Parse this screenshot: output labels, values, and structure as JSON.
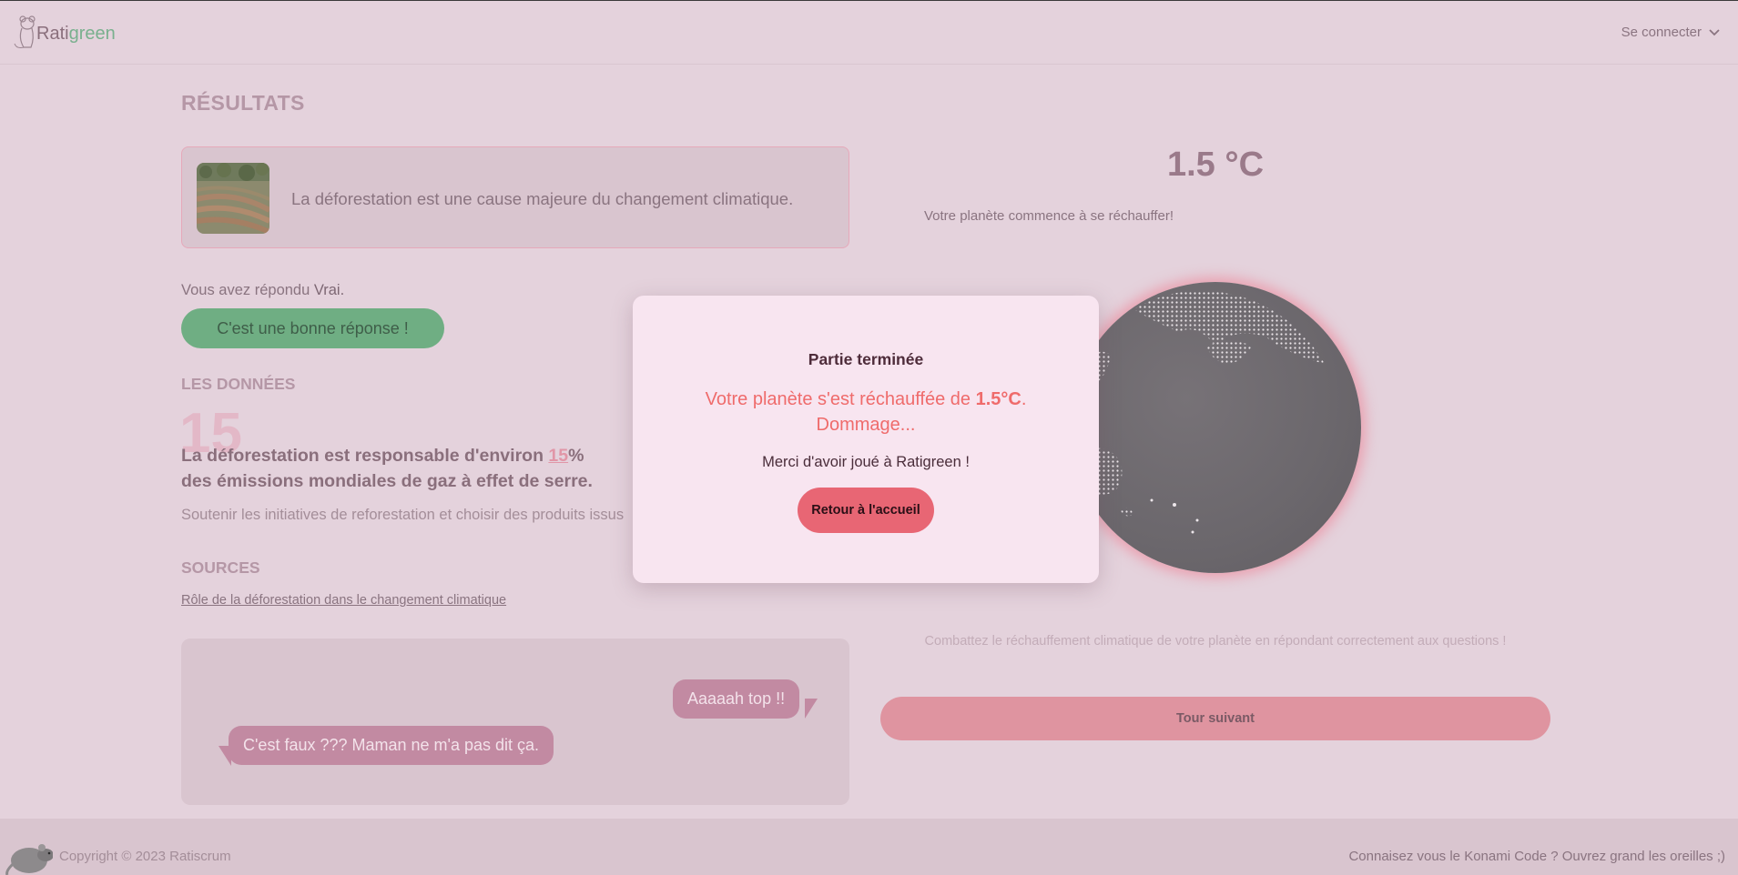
{
  "header": {
    "logo_part1": "Rati",
    "logo_part2": "green",
    "login_label": "Se connecter"
  },
  "results": {
    "title": "RÉSULTATS",
    "question": "La déforestation est une cause majeure du changement climatique.",
    "answered_prefix": "Vous avez répondu ",
    "answered_value": "Vrai.",
    "feedback_label": "C'est une bonne réponse !"
  },
  "data_section": {
    "heading": "LES DONNÉES",
    "big_number": "15",
    "fact_prefix": "La déforestation est responsable d'environ ",
    "fact_percent": "15",
    "fact_suffix": "%",
    "fact_line2": "des émissions mondiales de gaz à effet de serre.",
    "advice": "Soutenir les initiatives de reforestation et choisir des produits issus"
  },
  "sources": {
    "heading": "SOURCES",
    "link": "Rôle de la déforestation dans le changement climatique"
  },
  "chat": {
    "bubble_right": "Aaaaah top !!",
    "bubble_left": "C'est faux ??? Maman ne m'a pas dit ça."
  },
  "planet": {
    "temperature": "1.5 °C",
    "message": "Votre planète commence à se réchauffer!",
    "hint": "Combattez le réchauffement climatique de votre planète en répondant correctement aux questions !",
    "next_label": "Tour suivant"
  },
  "modal": {
    "title": "Partie terminée",
    "msg_prefix": "Votre planète s'est réchauffée de ",
    "msg_value": "1.5°C",
    "msg_suffix": ".",
    "msg_line2": "Dommage...",
    "thanks": "Merci d'avoir joué à Ratigreen !",
    "button_label": "Retour à l'accueil"
  },
  "footer": {
    "copyright": "Copyright © 2023 Ratiscrum",
    "konami": "Connaisez vous le Konami Code ? Ouvrez grand les oreilles ;)"
  },
  "colors": {
    "background": "#e4d2dc",
    "brand_green": "#79b08e",
    "accent_red": "#e86674",
    "modal_bg": "#f8e5f0"
  }
}
